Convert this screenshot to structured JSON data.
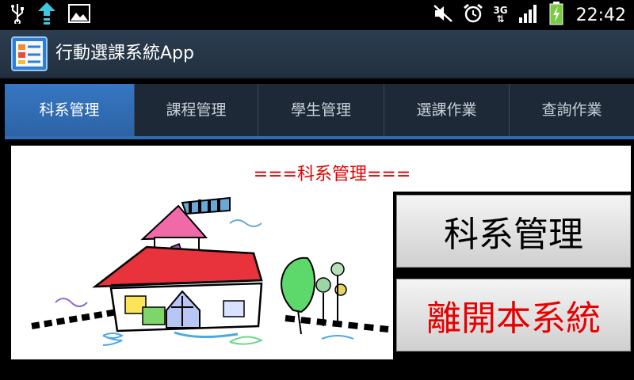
{
  "status_bar": {
    "left_icons": [
      "usb-icon",
      "upload-icon",
      "image-icon"
    ],
    "right_icons": [
      "mute-icon",
      "alarm-icon",
      "network-3g-icon",
      "signal-icon",
      "battery-charging-icon"
    ],
    "network": "3G",
    "time": "22:42"
  },
  "title_bar": {
    "title": "行動選課系統App",
    "icon": "app-icon"
  },
  "tabs": [
    {
      "label": "科系管理",
      "active": true
    },
    {
      "label": "課程管理",
      "active": false
    },
    {
      "label": "學生管理",
      "active": false
    },
    {
      "label": "選課作業",
      "active": false
    },
    {
      "label": "查詢作業",
      "active": false
    }
  ],
  "main": {
    "heading": "===科系管理===",
    "dept_button_label": "科系管理",
    "exit_button_label": "離開本系統",
    "colors": {
      "heading": "#e00000",
      "exit_text": "#e80000",
      "tab_active": "#3677c2"
    }
  }
}
